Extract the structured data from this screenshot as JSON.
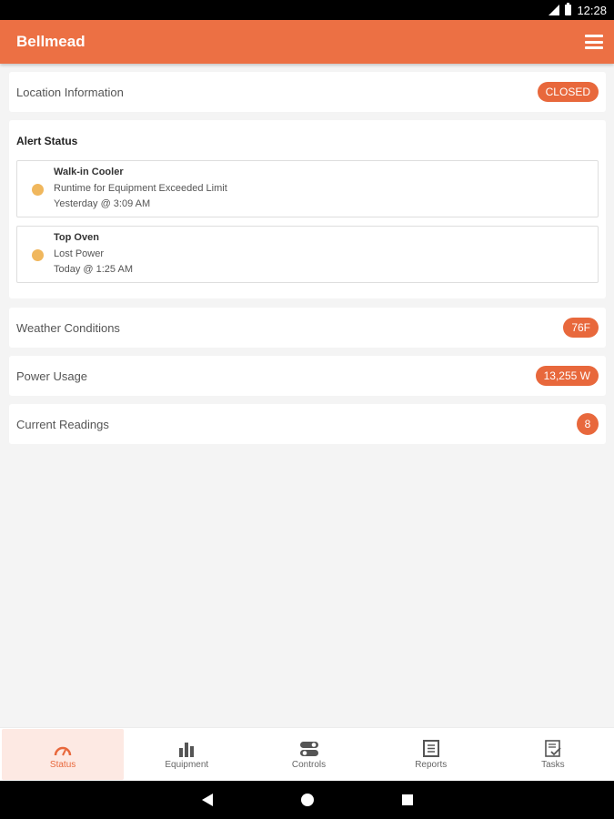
{
  "status_bar": {
    "time": "12:28"
  },
  "app_bar": {
    "title": "Bellmead"
  },
  "location": {
    "label": "Location Information",
    "status": "CLOSED"
  },
  "alerts": {
    "title": "Alert Status",
    "items": [
      {
        "name": "Walk-in Cooler",
        "description": "Runtime for Equipment Exceeded Limit",
        "time": "Yesterday @ 3:09 AM"
      },
      {
        "name": "Top Oven",
        "description": "Lost Power",
        "time": "Today @ 1:25 AM"
      }
    ]
  },
  "weather": {
    "label": "Weather Conditions",
    "value": "76F"
  },
  "power": {
    "label": "Power Usage",
    "value": "13,255 W"
  },
  "readings": {
    "label": "Current Readings",
    "value": "8"
  },
  "bottom_nav": {
    "items": [
      {
        "label": "Status",
        "icon": "gauge-icon"
      },
      {
        "label": "Equipment",
        "icon": "bar-chart-icon"
      },
      {
        "label": "Controls",
        "icon": "toggles-icon"
      },
      {
        "label": "Reports",
        "icon": "document-icon"
      },
      {
        "label": "Tasks",
        "icon": "task-list-icon"
      }
    ],
    "active": "Status"
  },
  "colors": {
    "accent": "#ec7044",
    "badge": "#e8683c",
    "alert_dot": "#f0b75d",
    "active_tab_bg": "#fde9e3"
  }
}
